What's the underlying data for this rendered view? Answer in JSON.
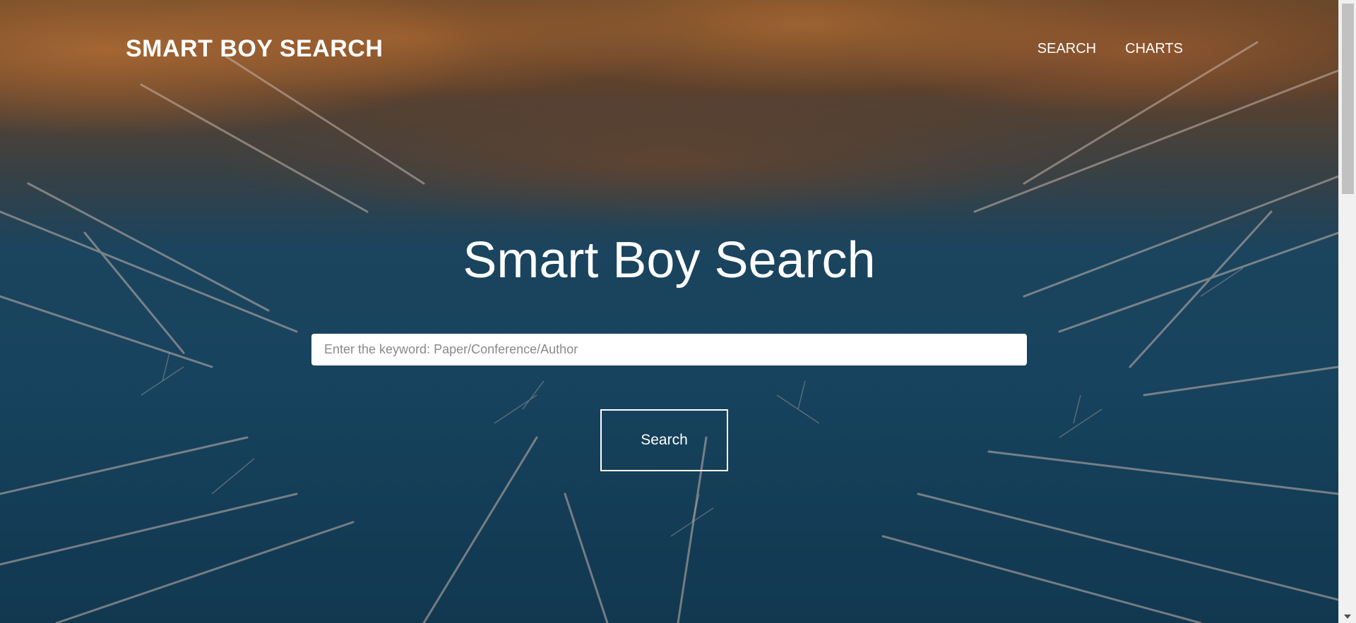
{
  "navbar": {
    "brand": "SMART BOY SEARCH",
    "links": [
      {
        "label": "SEARCH"
      },
      {
        "label": "CHARTS"
      }
    ]
  },
  "hero": {
    "title": "Smart Boy Search",
    "search": {
      "placeholder": "Enter the keyword: Paper/Conference/Author",
      "value": ""
    },
    "button_label": "Search"
  },
  "colors": {
    "text": "#ffffff",
    "water": "#1c4d6c",
    "foliage": "#c97a3a"
  }
}
